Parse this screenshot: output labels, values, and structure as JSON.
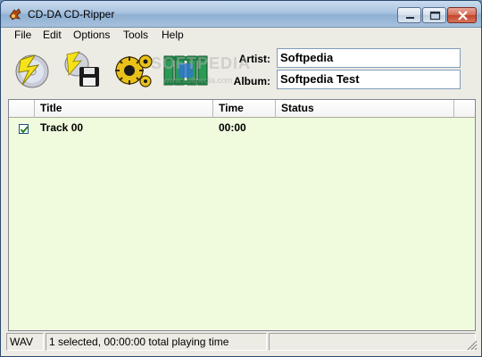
{
  "window": {
    "title": "CD-DA CD-Ripper",
    "min_icon": "minimize-icon",
    "max_icon": "maximize-icon",
    "close_icon": "close-icon"
  },
  "menu": [
    "File",
    "Edit",
    "Options",
    "Tools",
    "Help"
  ],
  "toolbar": {
    "buttons": [
      "rip-cd-icon",
      "save-disk-icon",
      "settings-gears-icon",
      "cddb-id3-icon"
    ],
    "artist_label": "Artist:",
    "artist_value": "Softpedia",
    "album_label": "Album:",
    "album_value": "Softpedia Test",
    "watermark": "SOFTPEDIA",
    "watermark_url": "www.softpedia.com"
  },
  "list": {
    "columns": [
      "Title",
      "Time",
      "Status"
    ],
    "rows": [
      {
        "checked": true,
        "title": "Track 00",
        "time": "00:00",
        "status": ""
      }
    ]
  },
  "status": {
    "format": "WAV",
    "summary": "1 selected, 00:00:00 total playing time",
    "extra": ""
  },
  "colors": {
    "list_background": "#f0fbde",
    "window_chrome": "#ecebe4"
  }
}
